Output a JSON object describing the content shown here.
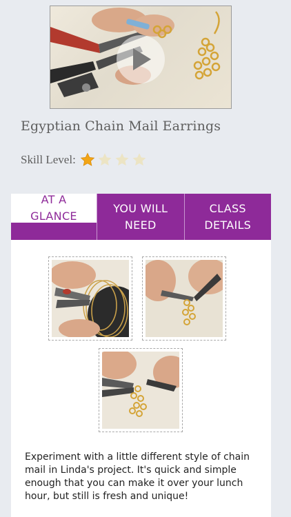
{
  "video": {
    "play_icon": "play-icon"
  },
  "title": "Egyptian Chain Mail Earrings",
  "skill": {
    "label": "Skill Level:",
    "rating": 1,
    "max": 4,
    "filled_color": "#f2a516",
    "empty_color": "#ece4c4"
  },
  "tabs": [
    {
      "label": "AT A GLANCE",
      "active": true
    },
    {
      "label": "YOU WILL NEED",
      "active": false
    },
    {
      "label": "CLASS DETAILS",
      "active": false
    }
  ],
  "colors": {
    "accent": "#8e2a99",
    "background": "#e8ebf0"
  },
  "panel": {
    "description": "Experiment with a little different style of chain mail in Linda's project. It's quick and simple enough that you can make it over your lunch hour, but still is fresh and unique!"
  }
}
